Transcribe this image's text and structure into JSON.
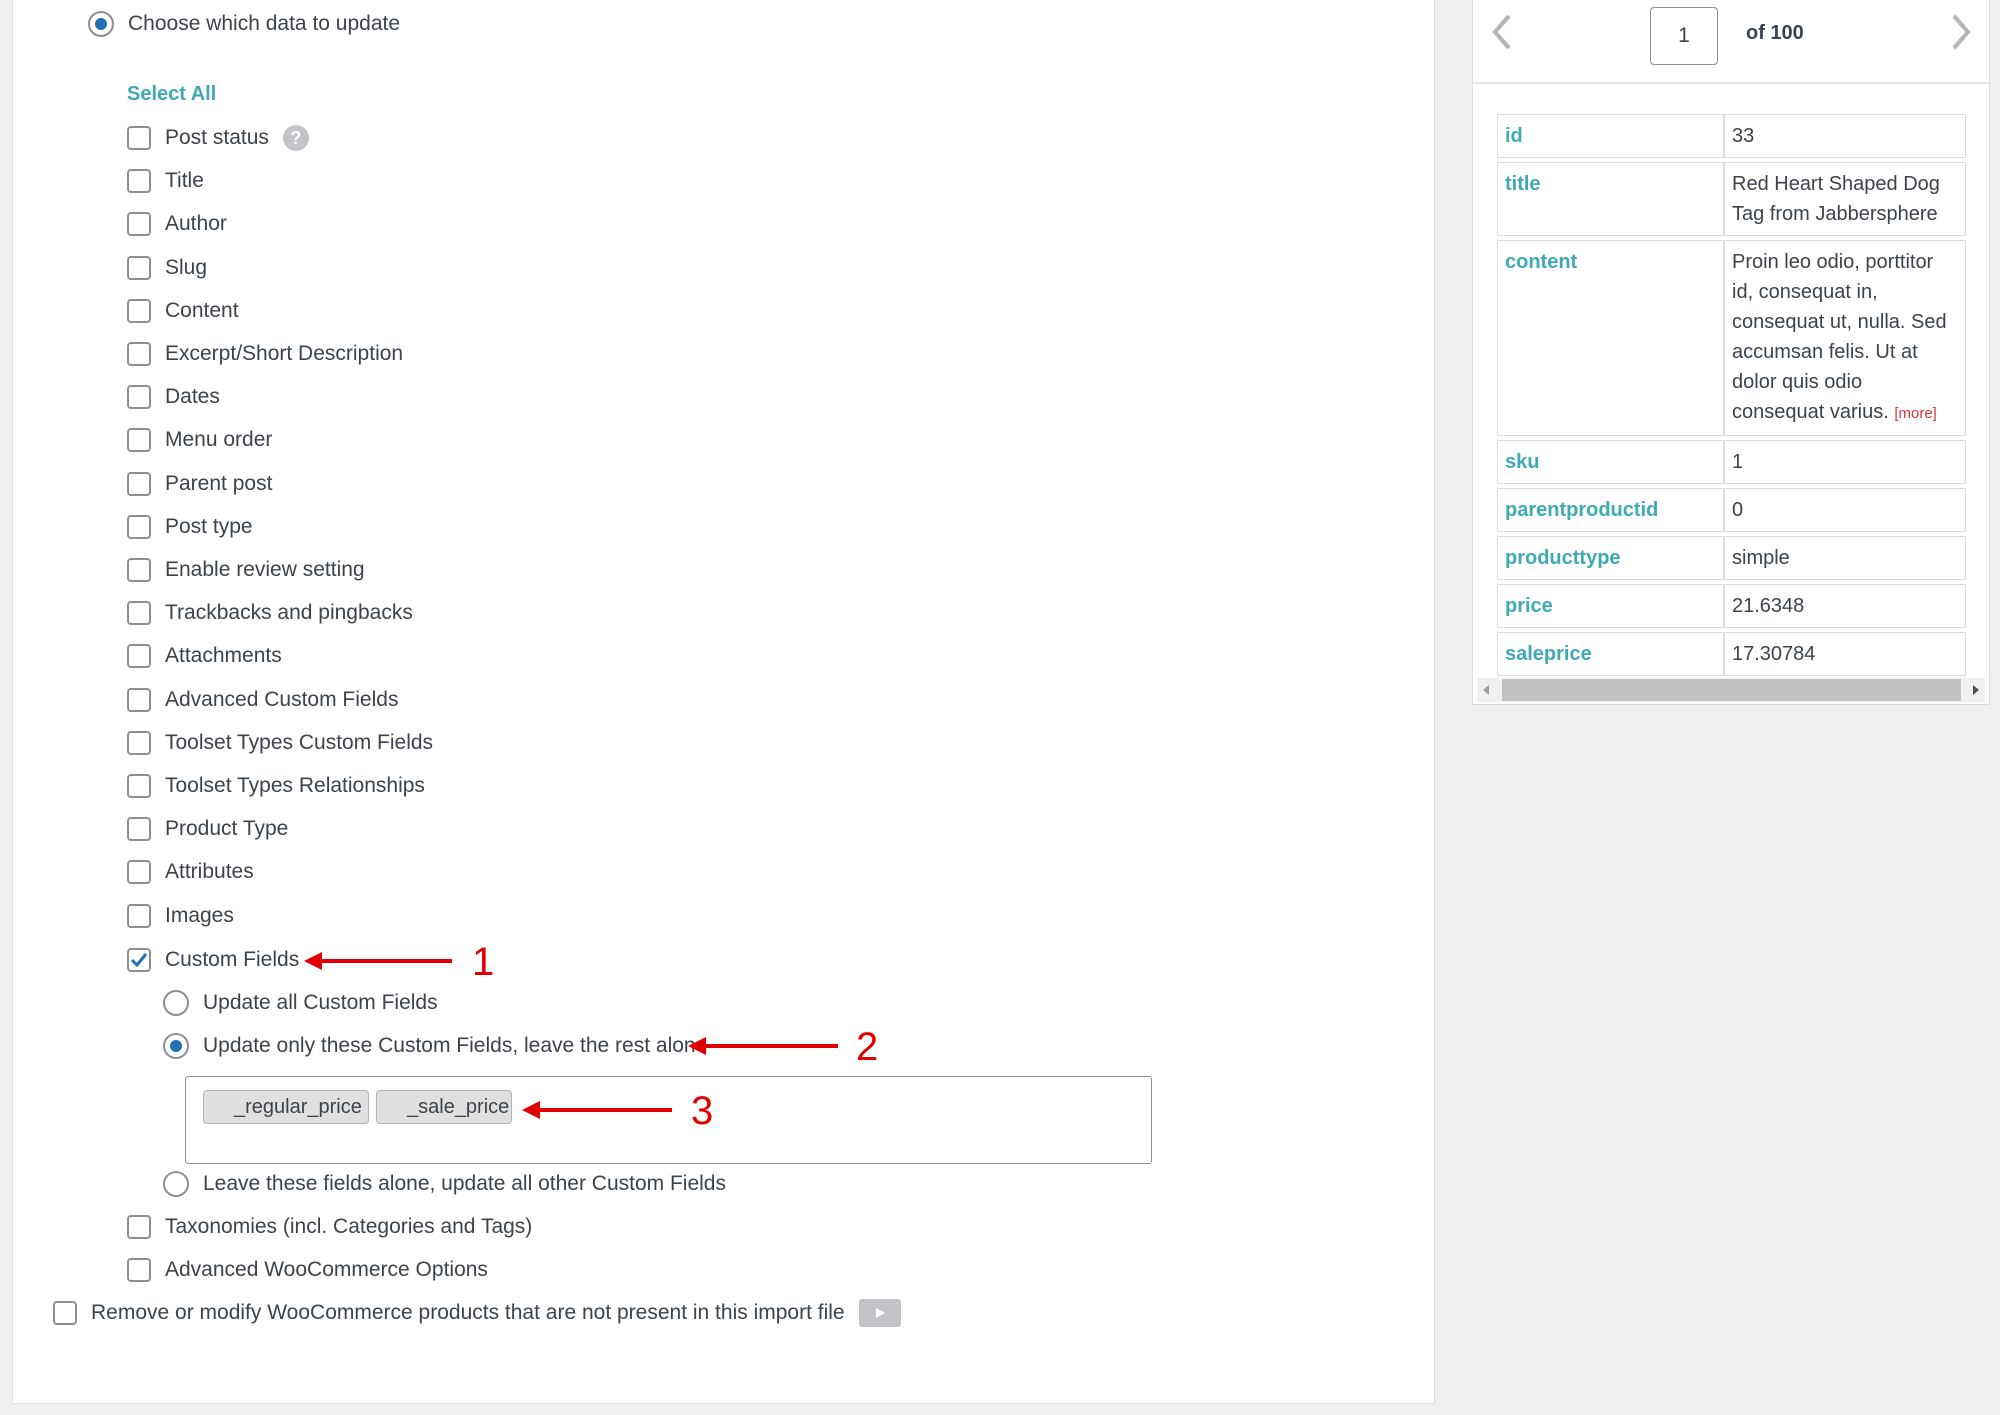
{
  "main": {
    "choose_radio_label": "Choose which data to update",
    "select_all": "Select All",
    "fields": [
      "Post status",
      "Title",
      "Author",
      "Slug",
      "Content",
      "Excerpt/Short Description",
      "Dates",
      "Menu order",
      "Parent post",
      "Post type",
      "Enable review setting",
      "Trackbacks and pingbacks",
      "Attachments",
      "Advanced Custom Fields",
      "Toolset Types Custom Fields",
      "Toolset Types Relationships",
      "Product Type",
      "Attributes",
      "Images"
    ],
    "custom_fields": {
      "label": "Custom Fields",
      "checked": true,
      "options": [
        "Update all Custom Fields",
        "Update only these Custom Fields, leave the rest alone",
        "Leave these fields alone, update all other Custom Fields"
      ],
      "selected_option": 1,
      "tags": [
        "_regular_price",
        "_sale_price"
      ]
    },
    "taxonomies": "Taxonomies (incl. Categories and Tags)",
    "advanced_woo": "Advanced WooCommerce Options",
    "remove_modify": "Remove or modify WooCommerce products that are not present in this import file"
  },
  "annotations": [
    "1",
    "2",
    "3"
  ],
  "annotation_color": "#e00000",
  "preview": {
    "page": "1",
    "of_total": "of 100",
    "rows": [
      {
        "key": "id",
        "value": "33"
      },
      {
        "key": "title",
        "value": "Red Heart Shaped Dog Tag from Jabbersphere"
      },
      {
        "key": "content",
        "value": "Proin leo odio, porttitor id, consequat in, consequat ut, nulla. Sed accumsan felis. Ut at dolor quis odio consequat varius.",
        "more": "[more]"
      },
      {
        "key": "sku",
        "value": "1"
      },
      {
        "key": "parentproductid",
        "value": "0"
      },
      {
        "key": "producttype",
        "value": "simple"
      },
      {
        "key": "price",
        "value": "21.6348"
      },
      {
        "key": "saleprice",
        "value": "17.30784"
      }
    ]
  },
  "colors": {
    "accent": "#3fa9b5",
    "radio_selected": "#2271b1",
    "annotation": "#e00000"
  }
}
